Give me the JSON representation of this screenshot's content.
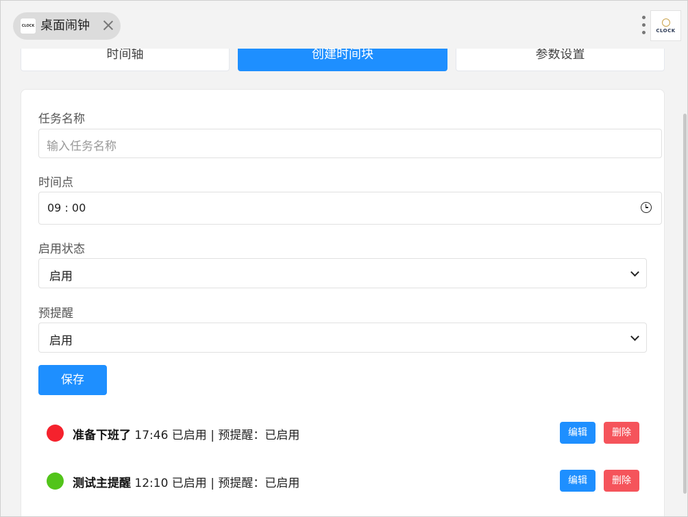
{
  "window": {
    "tab_title": "桌面闹钟",
    "tab_logo_text": "CLOCK",
    "app_logo_text": "CLOCK"
  },
  "nav": {
    "tabs": [
      {
        "label": "时间轴",
        "active": false
      },
      {
        "label": "创建时间块",
        "active": true
      },
      {
        "label": "参数设置",
        "active": false
      }
    ]
  },
  "form": {
    "task_name_label": "任务名称",
    "task_name_placeholder": "输入任务名称",
    "time_label": "时间点",
    "time_value": "09 : 00",
    "status_label": "启用状态",
    "status_value": "启用",
    "prereminder_label": "预提醒",
    "prereminder_value": "启用",
    "save_label": "保存"
  },
  "tasks": [
    {
      "name": "准备下班了",
      "detail": "17:46 已启用 | 预提醒：已启用",
      "color": "#f5222d",
      "edit": "编辑",
      "delete": "删除"
    },
    {
      "name": "测试主提醒",
      "detail": "12:10 已启用 | 预提醒：已启用",
      "color": "#52c41a",
      "edit": "编辑",
      "delete": "删除"
    }
  ],
  "colors": {
    "primary": "#1e8fff",
    "danger": "#f5545b"
  }
}
